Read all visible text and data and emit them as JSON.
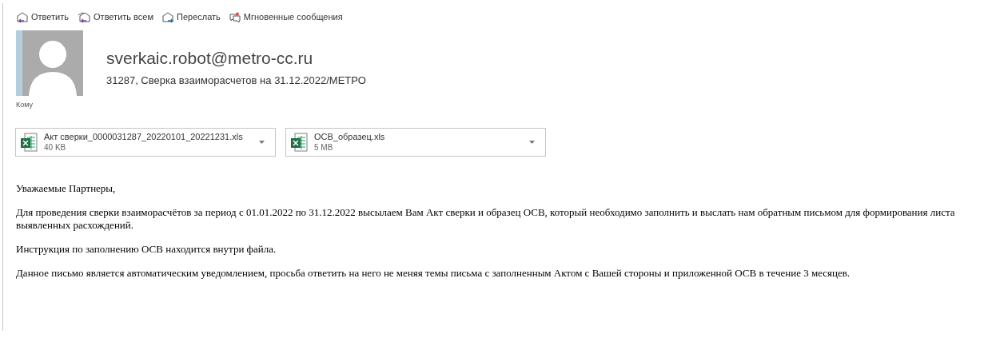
{
  "toolbar": [
    {
      "kind": "reply",
      "label": "Ответить"
    },
    {
      "kind": "reply_all",
      "label": "Ответить всем"
    },
    {
      "kind": "forward",
      "label": "Переслать"
    },
    {
      "kind": "im",
      "label": "Мгновенные сообщения"
    }
  ],
  "sender": "sverkaic.robot@metro-cc.ru",
  "subject": "31287, Сверка взаиморасчетов на 31.12.2022/МЕТРО",
  "to_label": "Кому",
  "attachments": [
    {
      "name": "Акт сверки_0000031287_20220101_20221231.xls",
      "size": "40 KB"
    },
    {
      "name": "ОСВ_образец.xls",
      "size": "5 MB"
    }
  ],
  "body": [
    "Уважаемые Партнеры,",
    "Для проведения сверки взаиморасчётов за период с 01.01.2022 по 31.12.2022 высылаем Вам Акт сверки и образец ОСВ, который необходимо заполнить и выслать нам обратным письмом для формирования листа выявленных расхождений.",
    "Инструкция по заполнению ОСВ находится внутри файла.",
    "Данное письмо является автоматическим уведомлением, просьба ответить на него не меняя темы письма с заполненным Актом с Вашей стороны и приложенной ОСВ в течение 3 месяцев."
  ]
}
